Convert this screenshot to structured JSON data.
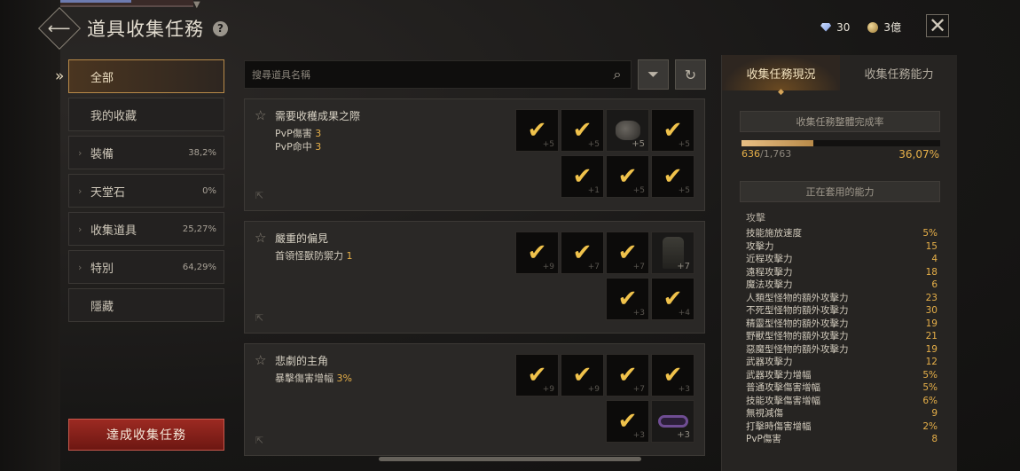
{
  "header": {
    "title": "道具收集任務",
    "help_label": "?",
    "diamonds": "30",
    "gold": "3億"
  },
  "nav": {
    "items": [
      {
        "label": "全部",
        "pct": "",
        "active": true
      },
      {
        "label": "我的收藏",
        "pct": ""
      },
      {
        "label": "裝備",
        "pct": "38,2%"
      },
      {
        "label": "天堂石",
        "pct": "0%"
      },
      {
        "label": "收集道具",
        "pct": "25,27%"
      },
      {
        "label": "特別",
        "pct": "64,29%"
      },
      {
        "label": "隱藏",
        "pct": ""
      }
    ],
    "complete_button": "達成收集任務"
  },
  "search": {
    "placeholder": "搜尋道具名稱"
  },
  "cards": [
    {
      "name": "需要收穫成果之際",
      "stats": [
        {
          "label": "PvP傷害",
          "value": "3"
        },
        {
          "label": "PvP命中",
          "value": "3"
        }
      ],
      "slots_row1": [
        {
          "type": "check",
          "plus": "+5"
        },
        {
          "type": "check",
          "plus": "+5"
        },
        {
          "type": "item",
          "plus": "+5"
        },
        {
          "type": "check",
          "plus": "+5"
        }
      ],
      "slots_row2": [
        {
          "type": "check",
          "plus": "+1"
        },
        {
          "type": "check",
          "plus": "+5"
        },
        {
          "type": "check",
          "plus": "+5"
        }
      ]
    },
    {
      "name": "嚴重的偏見",
      "stats": [
        {
          "label": "首領怪獸防禦力",
          "value": "1"
        }
      ],
      "slots_row1": [
        {
          "type": "check",
          "plus": "+9"
        },
        {
          "type": "check",
          "plus": "+7"
        },
        {
          "type": "check",
          "plus": "+7"
        },
        {
          "type": "item",
          "plus": "+7"
        }
      ],
      "slots_row2": [
        {
          "type": "check",
          "plus": "+3"
        },
        {
          "type": "check",
          "plus": "+4"
        }
      ]
    },
    {
      "name": "悲劇的主角",
      "stats": [
        {
          "label": "暴擊傷害增幅",
          "value": "3%"
        }
      ],
      "slots_row1": [
        {
          "type": "check",
          "plus": "+9"
        },
        {
          "type": "check",
          "plus": "+9"
        },
        {
          "type": "check",
          "plus": "+7"
        },
        {
          "type": "check",
          "plus": "+3"
        }
      ],
      "slots_row2": [
        {
          "type": "check",
          "plus": "+3"
        },
        {
          "type": "item",
          "plus": "+3"
        }
      ]
    }
  ],
  "right": {
    "tabs": [
      "收集任務現況",
      "收集任務能力"
    ],
    "overall_label": "收集任務整體完成率",
    "progress_current": "636",
    "progress_total": "/1,763",
    "progress_pct": "36,07%",
    "progress_value": 0.3607,
    "applied_label": "正在套用的能力",
    "category": "攻擊",
    "abilities": [
      {
        "name": "技能施放速度",
        "value": "5%"
      },
      {
        "name": "攻擊力",
        "value": "15"
      },
      {
        "name": "近程攻擊力",
        "value": "4"
      },
      {
        "name": "遠程攻擊力",
        "value": "18"
      },
      {
        "name": "魔法攻擊力",
        "value": "6"
      },
      {
        "name": "人類型怪物的額外攻擊力",
        "value": "23"
      },
      {
        "name": "不死型怪物的額外攻擊力",
        "value": "30"
      },
      {
        "name": "精靈型怪物的額外攻擊力",
        "value": "19"
      },
      {
        "name": "野獸型怪物的額外攻擊力",
        "value": "21"
      },
      {
        "name": "惡魔型怪物的額外攻擊力",
        "value": "19"
      },
      {
        "name": "武器攻擊力",
        "value": "12"
      },
      {
        "name": "武器攻擊力增幅",
        "value": "5%"
      },
      {
        "name": "普通攻擊傷害增幅",
        "value": "5%"
      },
      {
        "name": "技能攻擊傷害增幅",
        "value": "6%"
      },
      {
        "name": "無視減傷",
        "value": "9"
      },
      {
        "name": "打擊時傷害增幅",
        "value": "2%"
      },
      {
        "name": "PvP傷害",
        "value": "8"
      }
    ]
  }
}
